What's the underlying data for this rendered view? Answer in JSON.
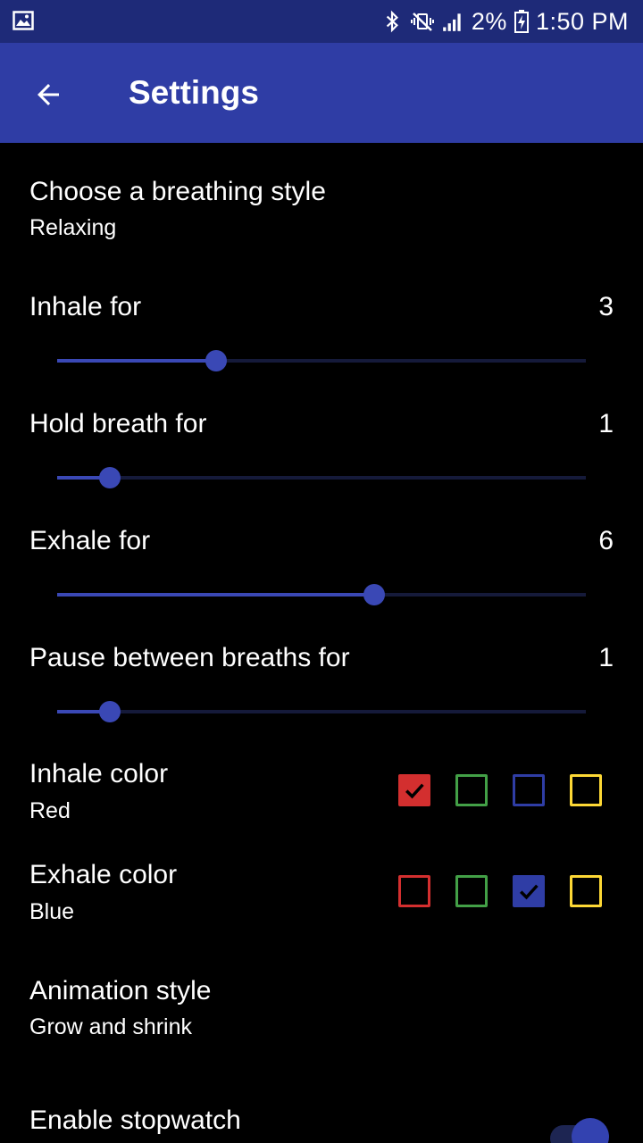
{
  "status_bar": {
    "battery_percent": "2%",
    "time": "1:50 PM",
    "icons": [
      "gallery-icon",
      "bluetooth-icon",
      "vibrate-mute-icon",
      "signal-icon",
      "battery-charging-icon"
    ]
  },
  "app_bar": {
    "title": "Settings",
    "back_icon": "arrow-back-icon"
  },
  "breathing_style": {
    "title": "Choose a breathing style",
    "summary": "Relaxing"
  },
  "sliders": [
    {
      "title": "Inhale for",
      "value": "3",
      "fraction": 0.3
    },
    {
      "title": "Hold breath for",
      "value": "1",
      "fraction": 0.1
    },
    {
      "title": "Exhale for",
      "value": "6",
      "fraction": 0.6
    },
    {
      "title": "Pause between breaths for",
      "value": "1",
      "fraction": 0.1
    }
  ],
  "inhale_color": {
    "title": "Inhale color",
    "summary": "Red",
    "selected": "red"
  },
  "exhale_color": {
    "title": "Exhale color",
    "summary": "Blue",
    "selected": "blue"
  },
  "color_options": [
    {
      "id": "red",
      "hex": "#d32f2f"
    },
    {
      "id": "green",
      "hex": "#43a047"
    },
    {
      "id": "blue",
      "hex": "#2f3da5"
    },
    {
      "id": "yellow",
      "hex": "#fdd835"
    }
  ],
  "animation_style": {
    "title": "Animation style",
    "summary": "Grow and shrink"
  },
  "stopwatch": {
    "title": "Enable stopwatch",
    "enabled": true
  },
  "colors": {
    "status_bar": "#1e2a78",
    "app_bar": "#2f3da5",
    "accent": "#3a48b5",
    "background": "#000000"
  }
}
